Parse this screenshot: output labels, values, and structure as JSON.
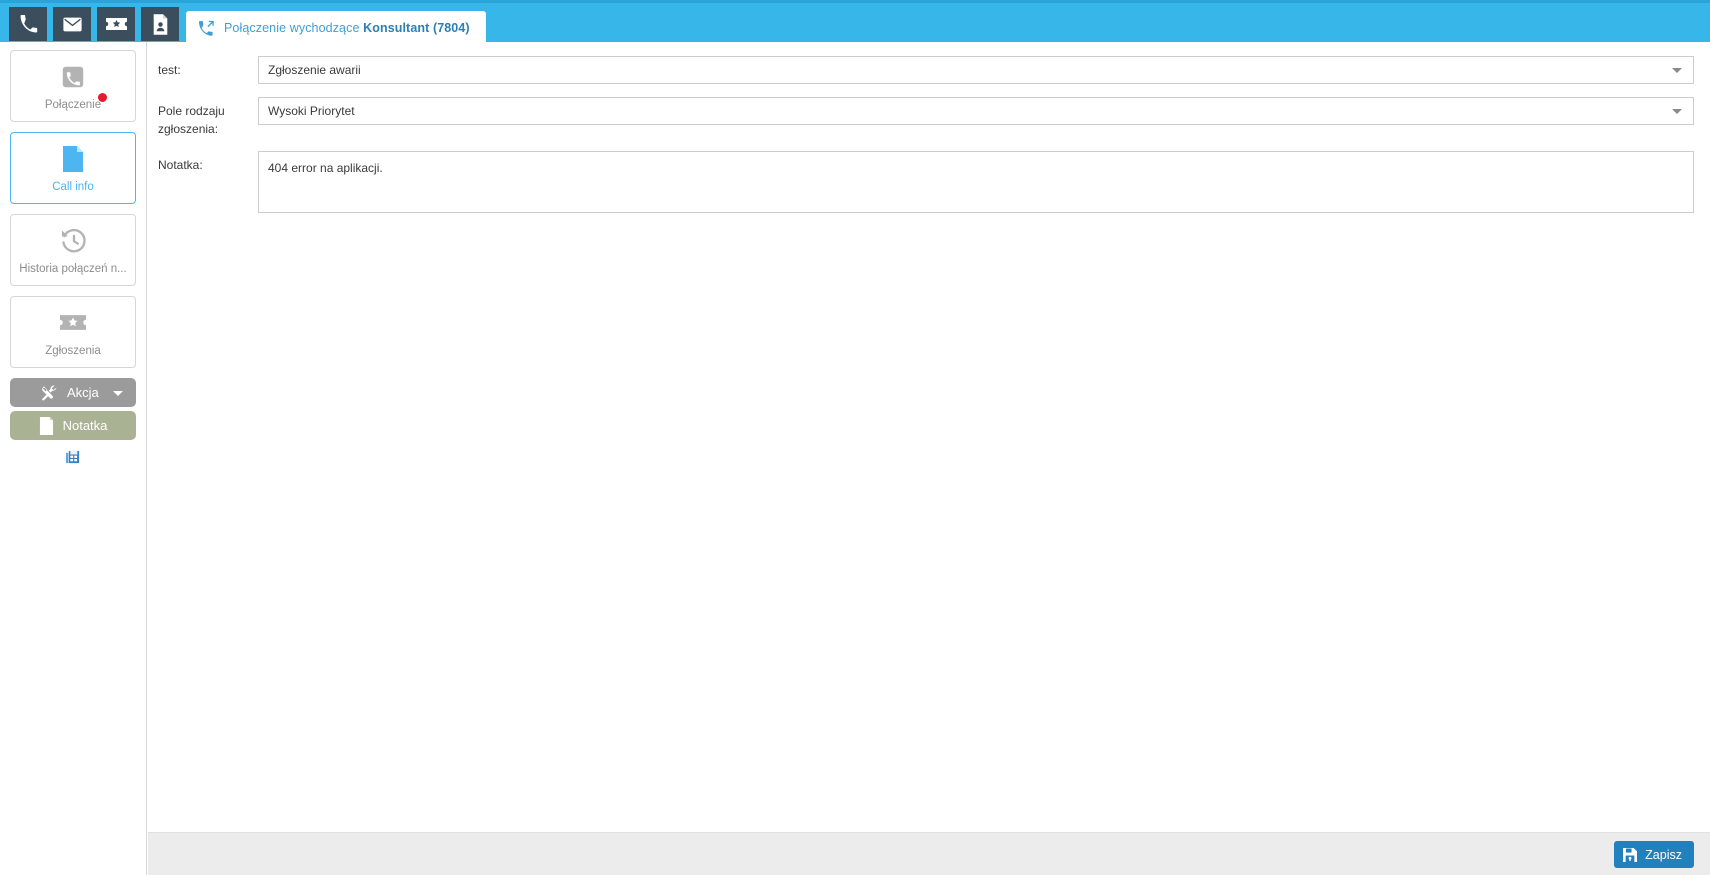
{
  "topbar": {
    "icons": [
      {
        "name": "phone-icon",
        "title": "Phone"
      },
      {
        "name": "envelope-icon",
        "title": "Mail"
      },
      {
        "name": "ticket-star-icon",
        "title": "Tickets"
      },
      {
        "name": "document-person-icon",
        "title": "Contact card"
      }
    ],
    "tab": {
      "icon": "outgoing-call-icon",
      "prefix": "Połączenie wychodzące ",
      "strong": "Konsultant (7804)"
    },
    "bg_color": "#37b6ea",
    "stripe_color": "#2aa3d8"
  },
  "sidebar": {
    "buttons": [
      {
        "label": "Połączenie",
        "icon": "phone-handset-icon",
        "active": false,
        "badge": true
      },
      {
        "label": "Call info",
        "icon": "document-page-icon",
        "active": true,
        "badge": false
      },
      {
        "label": "Historia połączeń n...",
        "icon": "history-clock-icon",
        "active": false,
        "badge": false
      },
      {
        "label": "Zgłoszenia",
        "icon": "ticket-star-icon",
        "active": false,
        "badge": false
      }
    ],
    "akcja": {
      "label": "Akcja",
      "icon": "tools-icon",
      "caret": "chevron-down-icon",
      "color": "#9b9b9b"
    },
    "notatka": {
      "label": "Notatka",
      "icon": "note-page-icon",
      "color": "#a9b394"
    },
    "mini_icon": {
      "name": "fax-report-icon",
      "color": "#3c7fc0"
    },
    "badge_color": "#e8192c",
    "active_color": "#4db5ef"
  },
  "form": {
    "fields": [
      {
        "label": "test:",
        "type": "select",
        "value": "Zgłoszenie awarii",
        "placeholder": "",
        "caret": "chevron-down-icon"
      },
      {
        "label": "Pole rodzaju zgłoszenia:",
        "type": "select",
        "value": "Wysoki Priorytet",
        "placeholder": "",
        "caret": "chevron-down-icon"
      },
      {
        "label": "Notatka:",
        "type": "textarea",
        "value": "404 error na aplikacji.",
        "placeholder": ""
      }
    ]
  },
  "footer": {
    "save": {
      "label": "Zapisz",
      "icon": "save-floppy-icon",
      "color": "#2280bd"
    },
    "bg_color": "#ececec"
  }
}
